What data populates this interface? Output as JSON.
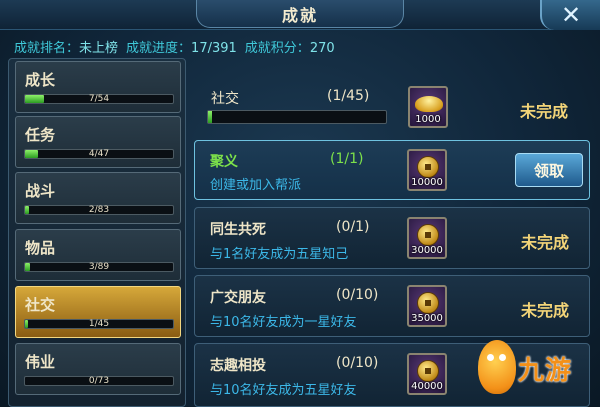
{
  "header": {
    "title": "成就",
    "close_glyph": "✕"
  },
  "stats": {
    "rank_label": "成就排名：",
    "rank_value": "未上榜",
    "progress_label": "成就进度：",
    "progress_value": "17/391",
    "points_label": "成就积分：",
    "points_value": "270"
  },
  "categories": [
    {
      "name": "成长",
      "count": "7/54",
      "progress": 0.13,
      "active": false
    },
    {
      "name": "任务",
      "count": "4/47",
      "progress": 0.085,
      "active": false
    },
    {
      "name": "战斗",
      "count": "2/83",
      "progress": 0.024,
      "active": false
    },
    {
      "name": "物品",
      "count": "3/89",
      "progress": 0.034,
      "active": false
    },
    {
      "name": "社交",
      "count": "1/45",
      "progress": 0.022,
      "active": true
    },
    {
      "name": "伟业",
      "count": "0/73",
      "progress": 0,
      "active": false
    }
  ],
  "summary": {
    "name": "社交",
    "progress": "(1/45)",
    "progress_fraction": 0.022,
    "reward_type": "gold-ingot-icon",
    "reward_amount": "1000",
    "status": "未完成"
  },
  "achievements": [
    {
      "title": "聚义",
      "progress": "(1/1)",
      "desc": "创建或加入帮派",
      "reward_amount": "10000",
      "action": "领取",
      "completed": true
    },
    {
      "title": "同生共死",
      "progress": "(0/1)",
      "desc": "与1名好友成为五星知己",
      "reward_amount": "30000",
      "status": "未完成",
      "completed": false
    },
    {
      "title": "广交朋友",
      "progress": "(0/10)",
      "desc": "与10名好友成为一星好友",
      "reward_amount": "35000",
      "status": "未完成",
      "completed": false
    },
    {
      "title": "志趣相投",
      "progress": "(0/10)",
      "desc": "与10名好友成为五星好友",
      "reward_amount": "40000",
      "status": "",
      "completed": false
    }
  ],
  "watermark": {
    "text": "九游"
  },
  "colors": {
    "accent_cyan": "#3fc8d8",
    "progress_green": "#2b9c22",
    "status_gold": "#f2d478",
    "desc_blue": "#3cb8e8",
    "active_tab": "#d6a83a"
  }
}
